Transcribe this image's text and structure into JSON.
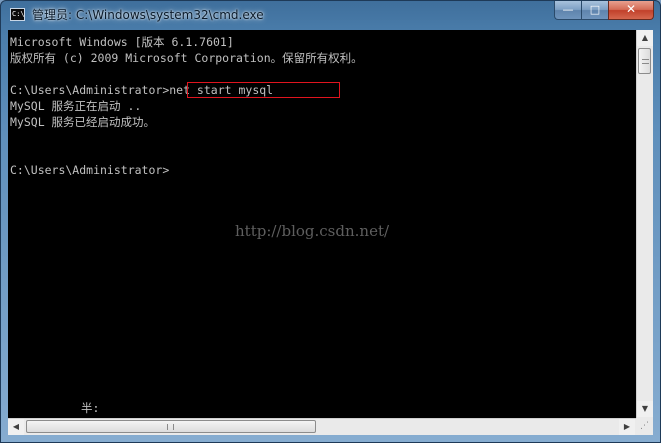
{
  "window": {
    "title": "管理员: C:\\Windows\\system32\\cmd.exe",
    "icon": "cmd-icon",
    "icon_glyph": "C:\\",
    "buttons": {
      "minimize": "—",
      "maximize": "□",
      "close": "✕"
    }
  },
  "console": {
    "lines": [
      "Microsoft Windows [版本 6.1.7601]",
      "版权所有 (c) 2009 Microsoft Corporation。保留所有权利。",
      "",
      "C:\\Users\\Administrator>net start mysql",
      "MySQL 服务正在启动 ..",
      "MySQL 服务已经启动成功。",
      "",
      "",
      "C:\\Users\\Administrator>"
    ],
    "highlighted_command": "net start mysql",
    "highlight_color": "#e0141e",
    "ime_indicator": "半:"
  },
  "watermark": "http://blog.csdn.net/",
  "scrollbars": {
    "up_arrow": "▲",
    "down_arrow": "▼",
    "left_arrow": "◀",
    "right_arrow": "▶",
    "size_grip": "⋰"
  }
}
